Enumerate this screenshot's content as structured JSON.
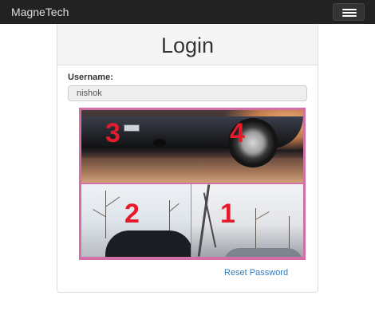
{
  "app": {
    "brand": "MagneTech"
  },
  "nav": {
    "menu_icon": "hamburger-icon"
  },
  "login": {
    "title": "Login",
    "username_label": "Username:",
    "username_value": "nishok"
  },
  "captcha": {
    "tiles": [
      {
        "label": "3"
      },
      {
        "label": "4"
      },
      {
        "label": "2"
      },
      {
        "label": "1"
      }
    ],
    "border_color": "#d36fa6",
    "number_color": "#e31b2b"
  },
  "links": {
    "reset_password": "Reset Password"
  }
}
